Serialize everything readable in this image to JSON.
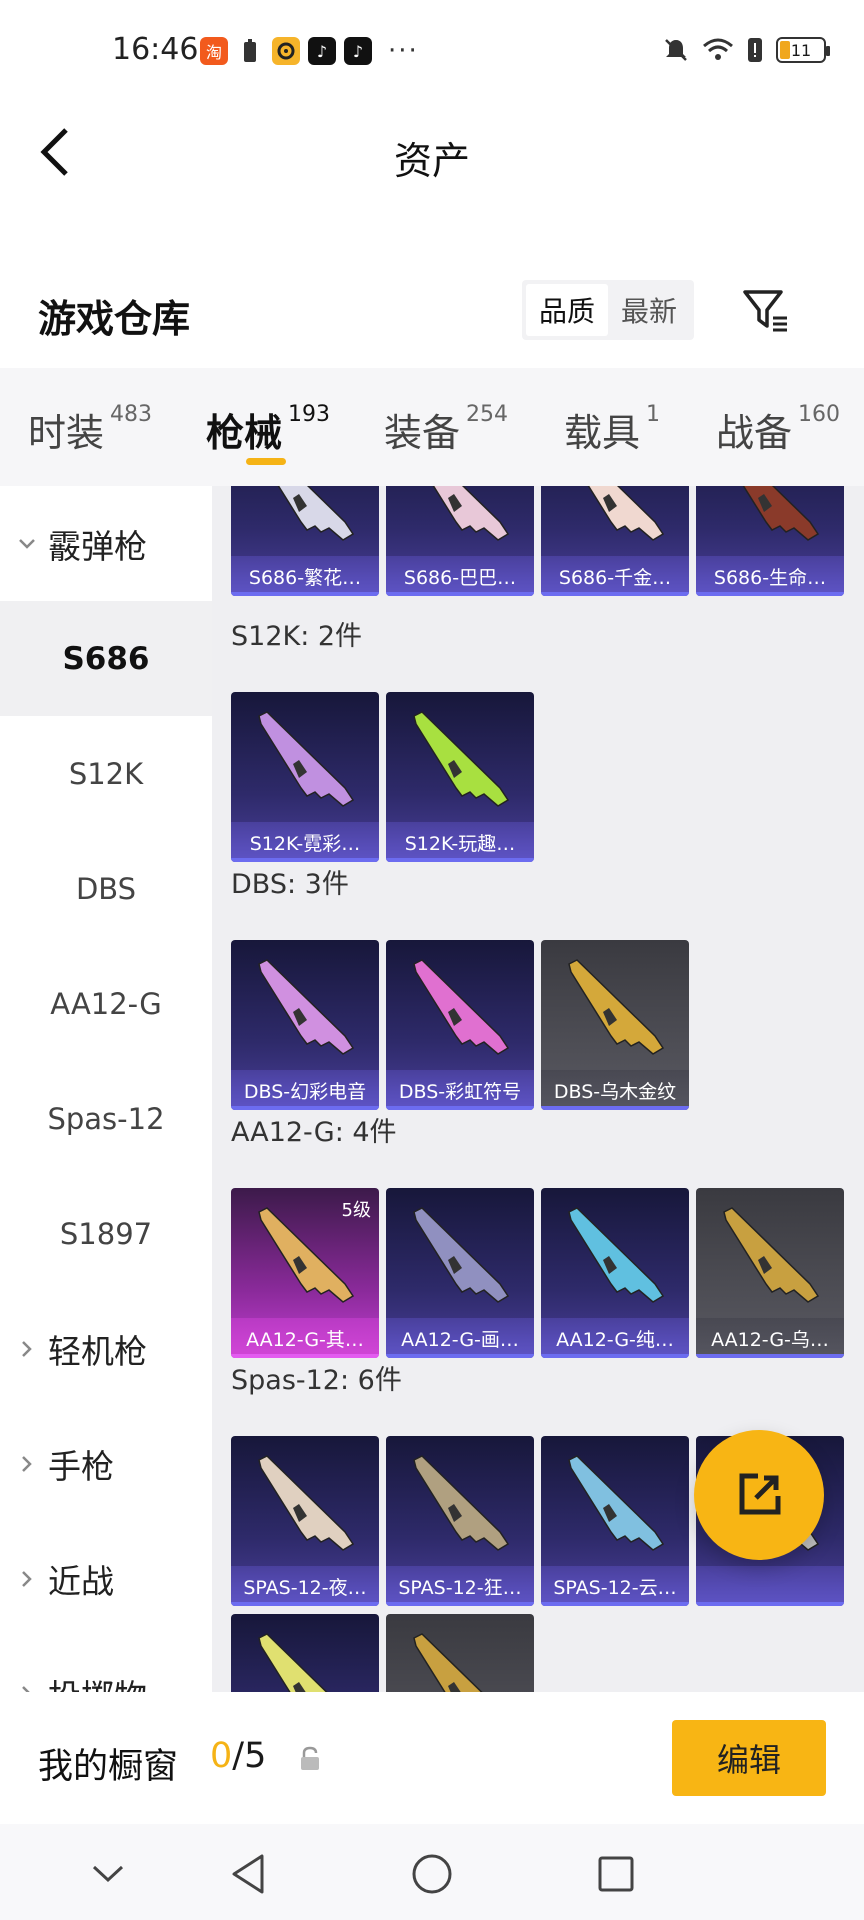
{
  "status_bar": {
    "time": "16:46",
    "battery_level": "11",
    "app_icons": [
      "taobao-icon",
      "notification-icon",
      "app-icon",
      "tiktok-icon",
      "tiktok-icon"
    ],
    "overflow": "···"
  },
  "header": {
    "title": "资产"
  },
  "warehouse": {
    "title": "游戏仓库",
    "sort_options": [
      "品质",
      "最新"
    ],
    "sort_selected": "品质"
  },
  "tabs": [
    {
      "label": "时装",
      "count": "483"
    },
    {
      "label": "枪械",
      "count": "193",
      "active": true
    },
    {
      "label": "装备",
      "count": "254"
    },
    {
      "label": "载具",
      "count": "1"
    },
    {
      "label": "战备",
      "count": "160"
    }
  ],
  "sidebar": {
    "groups": [
      {
        "label": "霰弹枪",
        "expanded": true
      },
      {
        "label": "轻机枪"
      },
      {
        "label": "手枪"
      },
      {
        "label": "近战"
      },
      {
        "label": "投掷物"
      }
    ],
    "items": [
      "S686",
      "S12K",
      "DBS",
      "AA12-G",
      "Spas-12",
      "S1897"
    ],
    "active_item": "S686"
  },
  "sections": [
    {
      "title": "",
      "cards": [
        {
          "name": "S686-繁花…"
        },
        {
          "name": "S686-巴巴…"
        },
        {
          "name": "S686-千金…"
        },
        {
          "name": "S686-生命…"
        }
      ]
    },
    {
      "title": "S12K: 2件",
      "cards": [
        {
          "name": "S12K-霓彩…"
        },
        {
          "name": "S12K-玩趣…"
        }
      ]
    },
    {
      "title": "DBS: 3件",
      "cards": [
        {
          "name": "DBS-幻彩电音"
        },
        {
          "name": "DBS-彩虹符号"
        },
        {
          "name": "DBS-乌木金纹"
        }
      ]
    },
    {
      "title": "AA12-G: 4件",
      "cards": [
        {
          "name": "AA12-G-其…",
          "badge": "5级"
        },
        {
          "name": "AA12-G-画…"
        },
        {
          "name": "AA12-G-纯…"
        },
        {
          "name": "AA12-G-乌…"
        }
      ]
    },
    {
      "title": "Spas-12: 6件",
      "cards": [
        {
          "name": "SPAS-12-夜…"
        },
        {
          "name": "SPAS-12-狂…"
        },
        {
          "name": "SPAS-12-云…"
        },
        {
          "name": ""
        },
        {
          "name": ""
        },
        {
          "name": ""
        }
      ]
    }
  ],
  "showcase": {
    "label": "我的橱窗",
    "current": "0",
    "total": "/5",
    "edit_label": "编辑"
  },
  "colors": {
    "accent": "#f8b514",
    "card_purple": "#2e2a6a",
    "card_gray": "#5a5a62",
    "card_pink": "#c23ed0"
  }
}
